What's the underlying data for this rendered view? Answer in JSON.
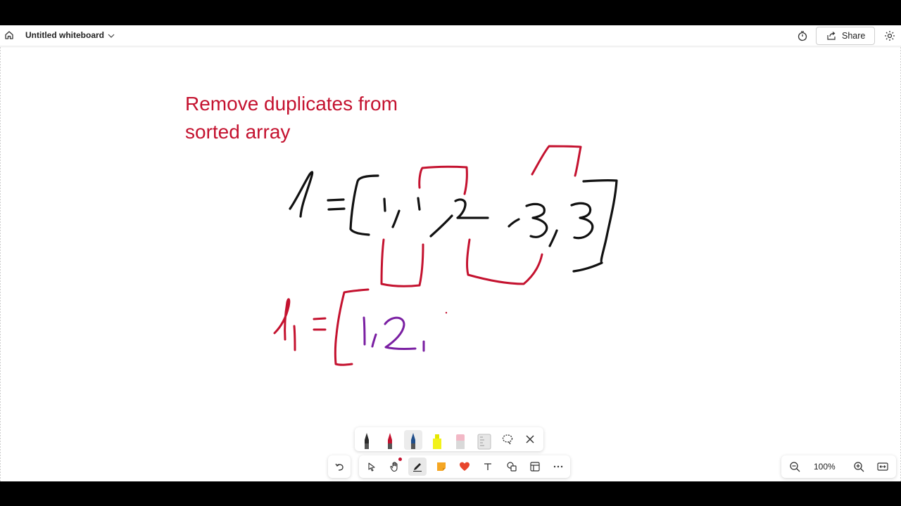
{
  "header": {
    "title": "Untitled whiteboard",
    "share_label": "Share"
  },
  "canvas": {
    "note_text_line1": "Remove duplicates from",
    "note_text_line2": "sorted array",
    "ink_colors": {
      "black": "#111111",
      "red": "#c4122f",
      "purple": "#7a1fa2"
    }
  },
  "pen_tray": {
    "pens": [
      "black-pen",
      "red-pen",
      "blue-pen",
      "highlighter",
      "eraser",
      "ruler"
    ],
    "selected": "blue-pen"
  },
  "toolbar": {
    "tools": [
      "select",
      "hand",
      "inking",
      "sticky-note",
      "reactions",
      "text",
      "shapes",
      "templates",
      "more"
    ],
    "active": "inking"
  },
  "zoom": {
    "level": "100%"
  },
  "colors": {
    "accent": "#c4122f",
    "sticky": "#f5a623",
    "heart": "#e8452c"
  }
}
